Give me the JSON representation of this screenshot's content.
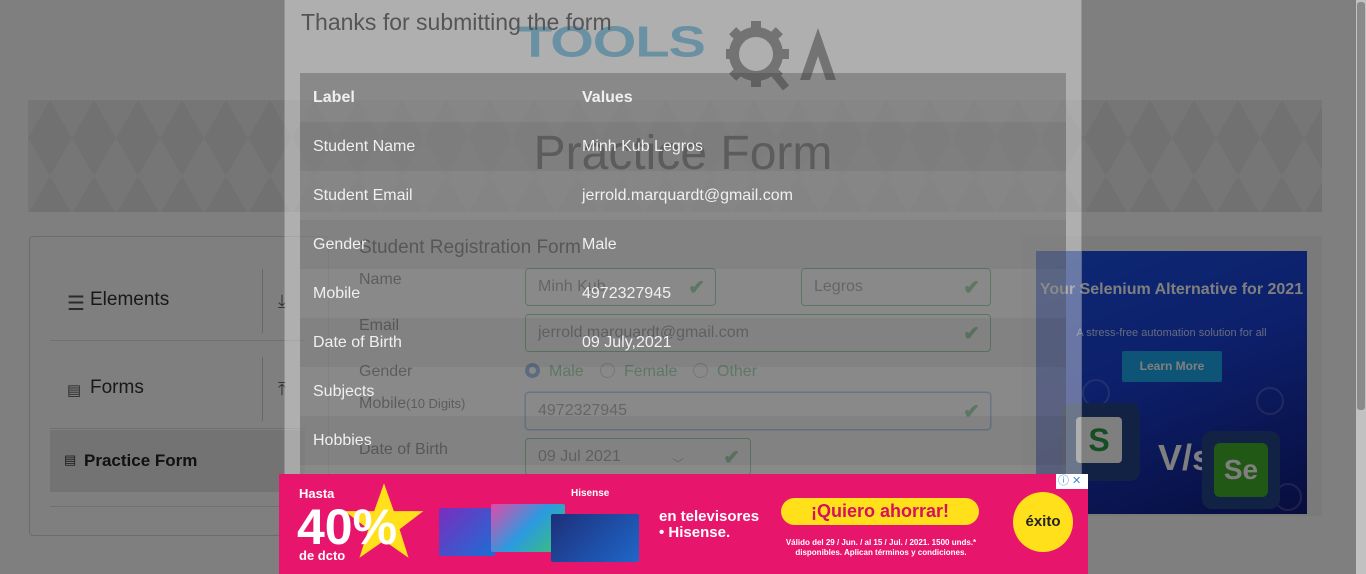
{
  "header": {
    "logo_text": "TOOLS",
    "logo_qa": "QA",
    "banner_title": "Practice Form"
  },
  "sidebar": {
    "groups": [
      {
        "label": "Elements",
        "icon": "hamburger-icon",
        "arrow": "download-icon"
      },
      {
        "label": "Forms",
        "icon": "document-icon",
        "arrow": "upload-icon"
      }
    ],
    "active_item": {
      "label": "Practice Form",
      "icon": "document-icon"
    }
  },
  "form": {
    "title": "Student Registration Form",
    "labels": {
      "name": "Name",
      "email": "Email",
      "gender": "Gender",
      "mobile": "Mobile",
      "mobile_hint": "(10 Digits)",
      "dob": "Date of Birth"
    },
    "first_name": "Minh Kub",
    "last_name": "Legros",
    "email": "jerrold.marquardt@gmail.com",
    "gender_options": [
      "Male",
      "Female",
      "Other"
    ],
    "gender_selected": "Male",
    "mobile": "4972327945",
    "dob": "09 Jul 2021",
    "valid_mark": "✔"
  },
  "modal": {
    "title": "Thanks for submitting the form",
    "columns": [
      "Label",
      "Values"
    ],
    "rows": [
      [
        "Student Name",
        "Minh Kub Legros"
      ],
      [
        "Student Email",
        "jerrold.marquardt@gmail.com"
      ],
      [
        "Gender",
        "Male"
      ],
      [
        "Mobile",
        "4972327945"
      ],
      [
        "Date of Birth",
        "09 July,2021"
      ],
      [
        "Subjects",
        ""
      ],
      [
        "Hobbies",
        ""
      ]
    ]
  },
  "side_ad": {
    "headline": "Your Selenium Alternative for 2021",
    "subline": "A stress-free automation solution for all",
    "button": "Learn More",
    "vs": "V/s",
    "left_logo": "S",
    "right_logo": "Se",
    "colors": {
      "bg": "#1a52e8",
      "button": "#1aa8ef"
    }
  },
  "bottom_ad": {
    "hasta": "Hasta",
    "percent": "40%",
    "dcto": "de dcto",
    "brand": "Hisense",
    "tv_text_1": "en televisores",
    "tv_text_2": "• Hisense.",
    "cta": "¡Quiero ahorrar!",
    "fine_print": "Válido del 29 / Jun. / al 15 / Jul. / 2021. 1500 unds.* disponibles. Aplican términos y condiciones.",
    "store": "éxito",
    "colors": {
      "bg": "#e8156d",
      "cta": "#ffe01b"
    }
  },
  "adchoice": "ⓘ ✕"
}
